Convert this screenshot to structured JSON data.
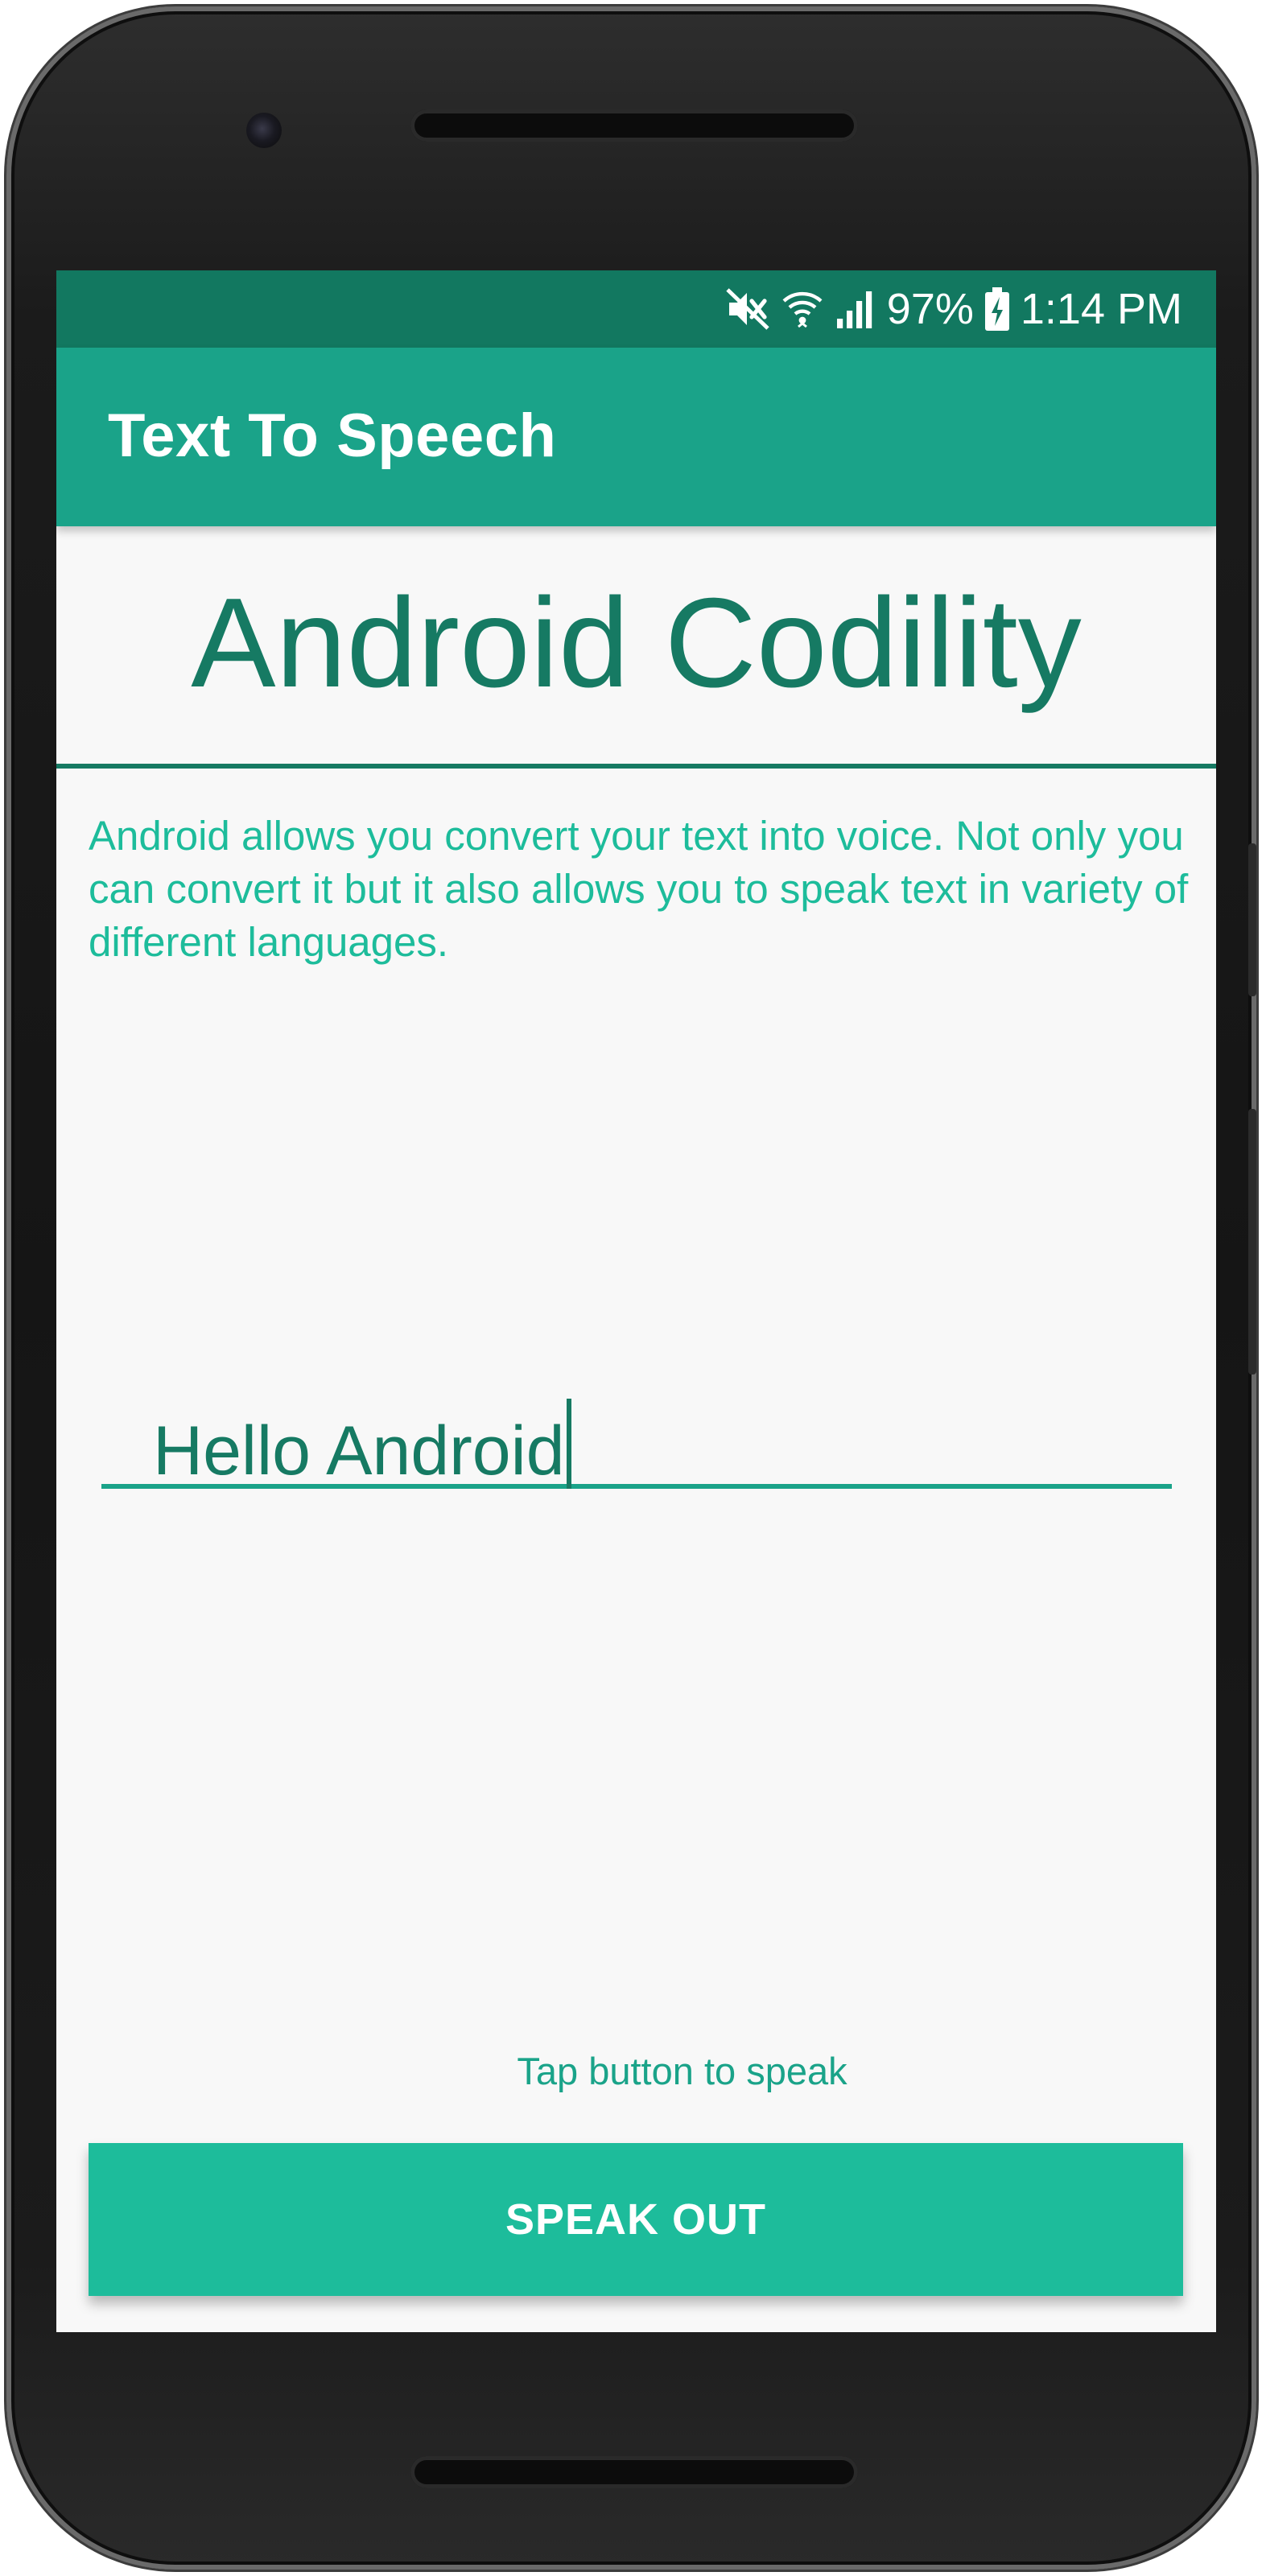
{
  "status_bar": {
    "battery": "97%",
    "time": "1:14 PM",
    "icons": [
      "mute-icon",
      "wifi-icon",
      "signal-icon",
      "battery-charging-icon"
    ]
  },
  "app_bar": {
    "title": "Text To Speech"
  },
  "main": {
    "heading": "Android Codility",
    "description": "Android allows you convert your text into voice. Not only you can convert it but it also allows you to speak text in variety of different languages.",
    "input_value": "Hello Android",
    "hint": "Tap button to speak",
    "button_label": "SPEAK OUT"
  },
  "colors": {
    "status_bar": "#127860",
    "app_bar": "#1aa389",
    "accent": "#1dbc9b",
    "heading": "#167a63",
    "background": "#f8f8f8"
  }
}
